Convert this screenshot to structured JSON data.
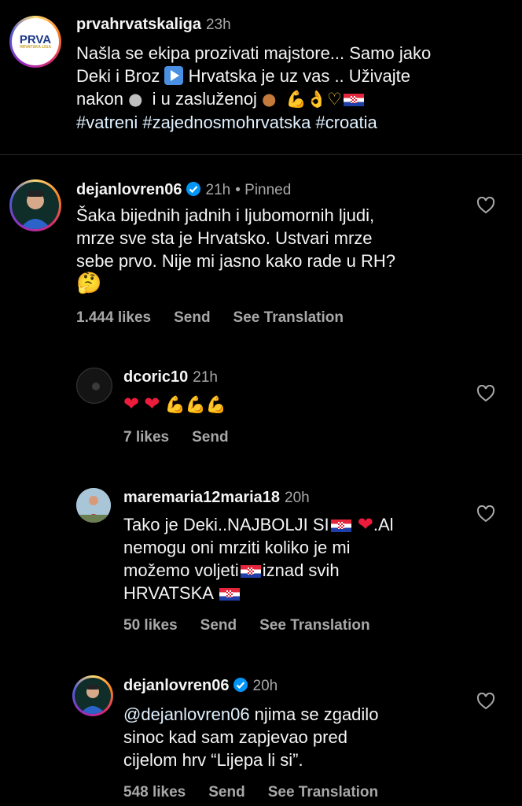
{
  "caption": {
    "username": "prvahrvatskaliga",
    "time": "23h",
    "avatar_text": "PRVA",
    "avatar_subtext": "HRVATSKA LIGA",
    "line1": "Našla se ekipa prozivati majstore... Samo jako",
    "line2a": "Deki i Broz",
    "line2b": "Hrvatska je uz vas .. Uživajte",
    "line3a": "nakon",
    "line3b": "i u zasluženoj",
    "hashtags": "#vatreni #zajednosmohrvatska #croatia"
  },
  "comments": [
    {
      "username": "dejanlovren06",
      "time": "21h",
      "pinned": "• Pinned",
      "text": "Šaka bijednih jadnih i ljubomornih ljudi,\nmrze sve sta je Hrvatsko. Ustvari mrze\nsebe prvo. Nije mi jasno kako rade u RH?",
      "emoji": "🤔",
      "likes": "1.444 likes",
      "send": "Send",
      "translate": "See Translation"
    },
    {
      "username": "dcoric10",
      "time": "21h",
      "likes": "7 likes",
      "send": "Send"
    },
    {
      "username": "maremaria12maria18",
      "time": "20h",
      "line1a": "Tako je Deki..NAJBOLJI SI",
      "line1b": ".Al",
      "line2": "nemogu oni mrziti koliko je mi",
      "line3a": "možemo voljeti",
      "line3b": "iznad svih",
      "line4": "HRVATSKA",
      "likes": "50 likes",
      "send": "Send",
      "translate": "See Translation"
    },
    {
      "username": "dejanlovren06",
      "time": "20h",
      "mention": "@dejanlovren06",
      "line1": " njima se zgadilo",
      "line2": "sinoc kad sam zapjevao pred",
      "line3": "cijelom hrv “Lijepa li si”.",
      "likes": "548 likes",
      "send": "Send",
      "translate": "See Translation"
    }
  ],
  "colors": {
    "background": "#000000",
    "muted": "#a8a8a8",
    "verified": "#0095f6",
    "text": "#f5f5f5"
  },
  "icons": [
    "heart-icon",
    "verified-badge-icon"
  ]
}
